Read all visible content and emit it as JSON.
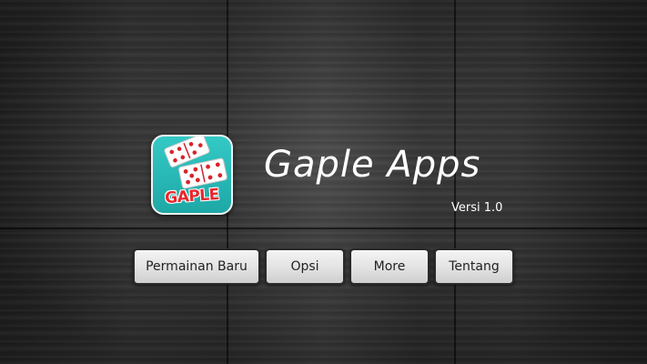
{
  "app": {
    "title": "Gaple Apps",
    "version": "Versi 1.0",
    "logo_label": "GAPLE",
    "logo_bg": "#1ea8a6",
    "logo_text_color": "#e8262c"
  },
  "menu": {
    "new_game": "Permainan Baru",
    "options": "Opsi",
    "more": "More",
    "about": "Tentang"
  },
  "theme": {
    "background": "dark-wood",
    "button_bg": "#e6e6e6"
  }
}
